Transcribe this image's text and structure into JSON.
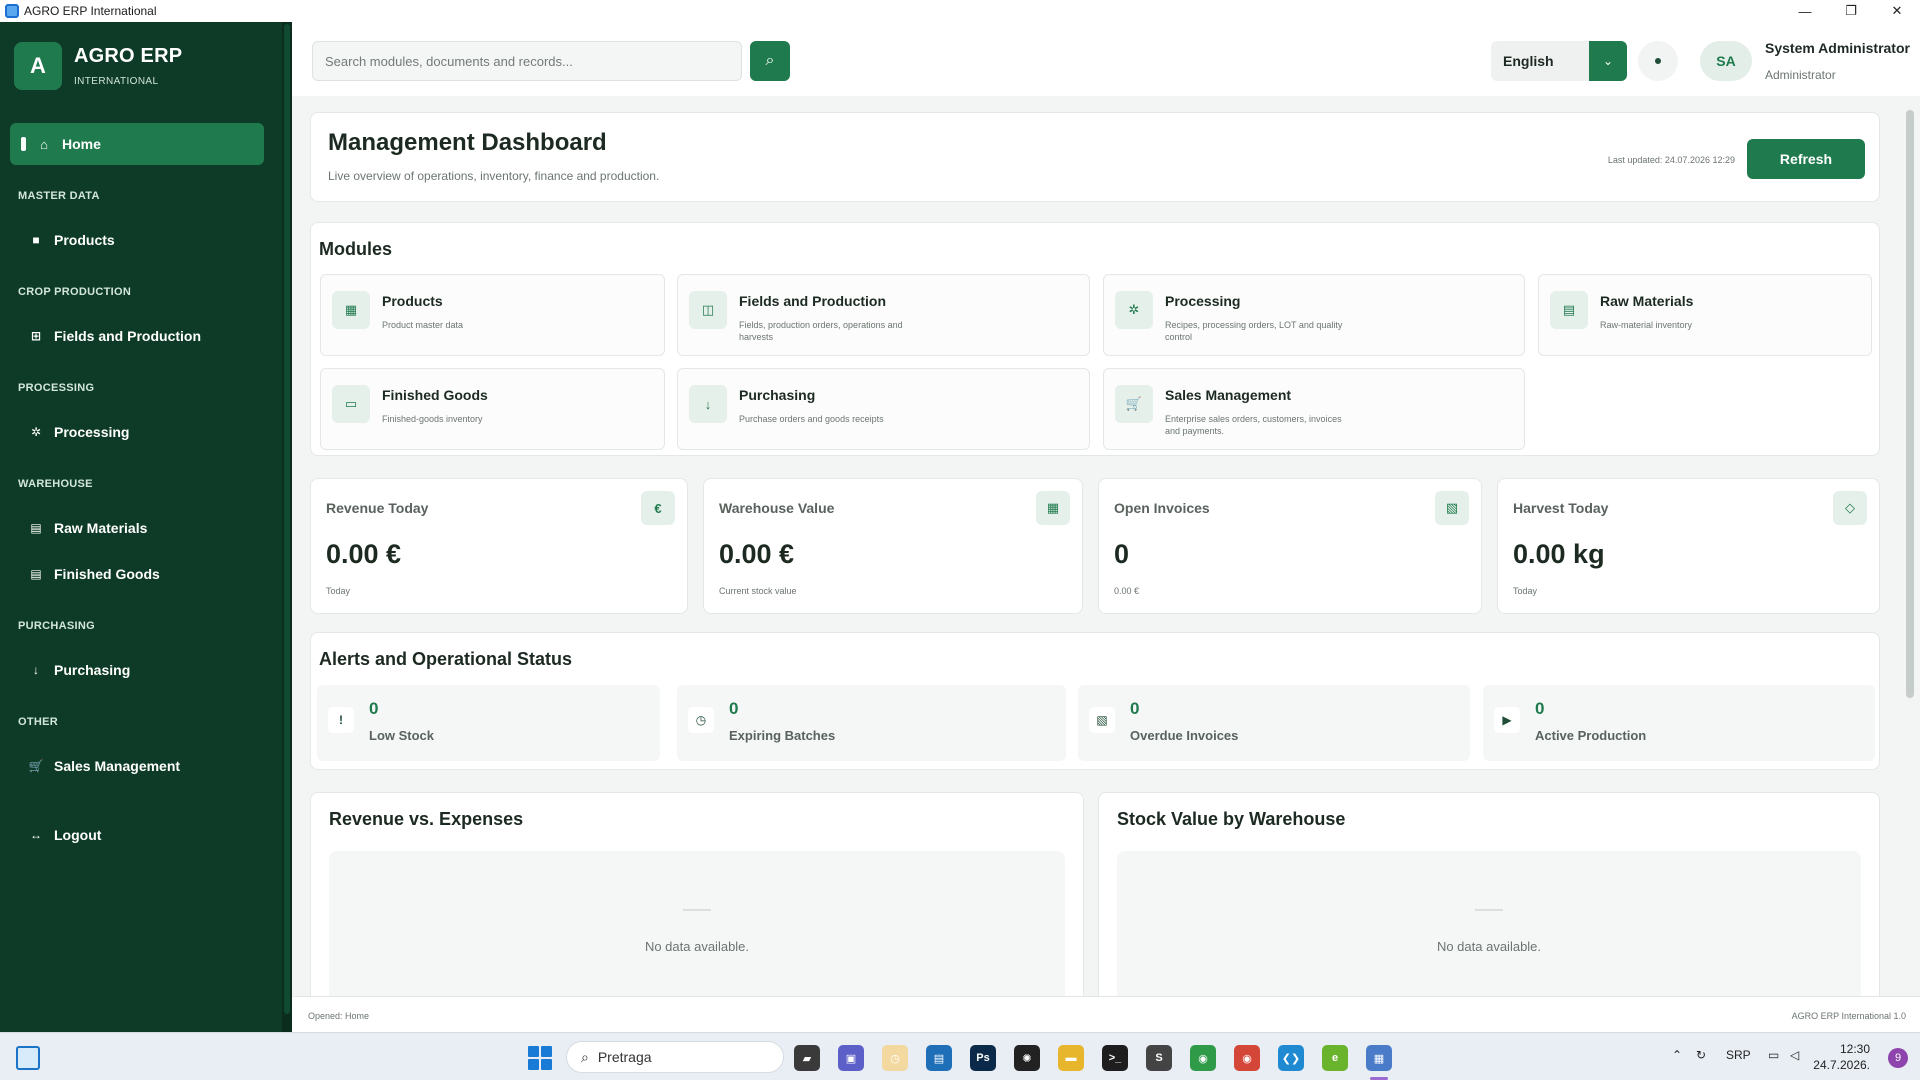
{
  "window": {
    "title": "AGRO ERP International",
    "controls": [
      "—",
      "❐",
      "✕"
    ]
  },
  "brand": {
    "initial": "A",
    "name": "AGRO ERP",
    "subtitle": "INTERNATIONAL"
  },
  "sidebar": {
    "home": {
      "icon": "home-icon",
      "glyph": "⌂",
      "label": "Home"
    },
    "sections": {
      "master_data": "MASTER DATA",
      "crop_production": "CROP PRODUCTION",
      "processing": "PROCESSING",
      "warehouse": "WAREHOUSE",
      "purchasing": "PURCHASING",
      "other": "OTHER"
    },
    "items": {
      "products": {
        "glyph": "■",
        "label": "Products"
      },
      "fields": {
        "glyph": "⊞",
        "label": "Fields and Production"
      },
      "processing": {
        "glyph": "✲",
        "label": "Processing"
      },
      "raw_materials": {
        "glyph": "▤",
        "label": "Raw Materials"
      },
      "finished_goods": {
        "glyph": "▤",
        "label": "Finished Goods"
      },
      "purchasing": {
        "glyph": "↓",
        "label": "Purchasing"
      },
      "sales": {
        "glyph": "🛒",
        "label": "Sales Management"
      },
      "logout": {
        "glyph": "↔",
        "label": "Logout"
      }
    }
  },
  "header": {
    "search_placeholder": "Search modules, documents and records...",
    "search_glyph": "⌕",
    "language": "English",
    "language_glyph": "⌄",
    "user_initials": "SA",
    "user_name": "System Administrator",
    "user_role": "Administrator"
  },
  "dashboard": {
    "title": "Management Dashboard",
    "subtitle": "Live overview of operations, inventory, finance and production.",
    "last_updated": "Last updated: 24.07.2026 12:29",
    "refresh_label": "Refresh"
  },
  "modules": {
    "title": "Modules",
    "items": [
      {
        "glyph": "▦",
        "title": "Products",
        "desc": "Product master data"
      },
      {
        "glyph": "◫",
        "title": "Fields and Production",
        "desc": "Fields, production orders, operations and harvests"
      },
      {
        "glyph": "✲",
        "title": "Processing",
        "desc": "Recipes, processing orders, LOT and quality control"
      },
      {
        "glyph": "▤",
        "title": "Raw Materials",
        "desc": "Raw-material inventory"
      },
      {
        "glyph": "▭",
        "title": "Finished Goods",
        "desc": "Finished-goods inventory"
      },
      {
        "glyph": "↓",
        "title": "Purchasing",
        "desc": "Purchase orders and goods receipts"
      },
      {
        "glyph": "🛒",
        "title": "Sales Management",
        "desc": "Enterprise sales orders, customers, invoices and payments."
      }
    ]
  },
  "kpis": [
    {
      "label": "Revenue Today",
      "value": "0.00 €",
      "sub": "Today",
      "glyph": "€"
    },
    {
      "label": "Warehouse Value",
      "value": "0.00 €",
      "sub": "Current stock value",
      "glyph": "▦"
    },
    {
      "label": "Open Invoices",
      "value": "0",
      "sub": "0.00 €",
      "glyph": "▧"
    },
    {
      "label": "Harvest Today",
      "value": "0.00 kg",
      "sub": "Today",
      "glyph": "◇"
    }
  ],
  "alerts": {
    "title": "Alerts and Operational Status",
    "items": [
      {
        "glyph": "!",
        "value": "0",
        "label": "Low Stock"
      },
      {
        "glyph": "◷",
        "value": "0",
        "label": "Expiring Batches"
      },
      {
        "glyph": "▧",
        "value": "0",
        "label": "Overdue Invoices"
      },
      {
        "glyph": "▶",
        "value": "0",
        "label": "Active Production"
      }
    ]
  },
  "charts": {
    "revenue": {
      "title": "Revenue vs. Expenses",
      "empty": "No data available."
    },
    "stock": {
      "title": "Stock Value by Warehouse",
      "empty": "No data available."
    }
  },
  "statusbar": {
    "opened": "Opened: Home",
    "version": "AGRO ERP International 1.0"
  },
  "taskbar": {
    "search_label": "Pretraga",
    "lang": "SRP",
    "time": "12:30",
    "date": "24.7.2026.",
    "notifications": "9",
    "apps": [
      {
        "name": "file-manager-icon",
        "glyph": "▰",
        "color": "#3a3a3a"
      },
      {
        "name": "teams-icon",
        "glyph": "▣",
        "color": "#5b5fc7"
      },
      {
        "name": "clock-app-icon",
        "glyph": "◷",
        "color": "#f3d9a0"
      },
      {
        "name": "store-icon",
        "glyph": "▤",
        "color": "#1f6fb8"
      },
      {
        "name": "photoshop-icon",
        "glyph": "Ps",
        "color": "#0b2a4a"
      },
      {
        "name": "chatgpt-icon",
        "glyph": "✺",
        "color": "#222222"
      },
      {
        "name": "folder-icon",
        "glyph": "▬",
        "color": "#e8b62c"
      },
      {
        "name": "terminal-icon",
        "glyph": ">_",
        "color": "#1e1e1e"
      },
      {
        "name": "app-s-icon",
        "glyph": "S",
        "color": "#444444"
      },
      {
        "name": "chrome-icon",
        "glyph": "◉",
        "color": "#2f9a48"
      },
      {
        "name": "chrome-alt-icon",
        "glyph": "◉",
        "color": "#d44638"
      },
      {
        "name": "vscode-icon",
        "glyph": "❮❯",
        "color": "#1f8ad2"
      },
      {
        "name": "edge-green-icon",
        "glyph": "e",
        "color": "#6ab42d"
      },
      {
        "name": "agro-erp-taskbar-icon",
        "glyph": "▦",
        "color": "#4a7bc8"
      }
    ]
  }
}
